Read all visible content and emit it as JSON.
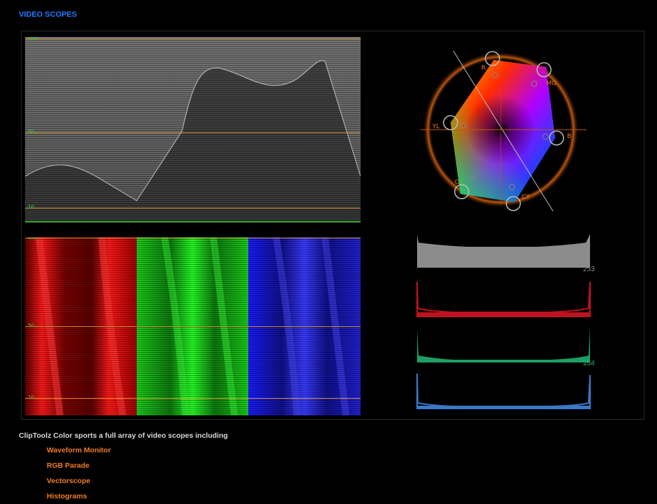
{
  "page": {
    "title": "VIDEO SCOPES",
    "accent_color": "#1f7bff"
  },
  "waveform": {
    "scale_labels": [
      "100",
      "50",
      "10"
    ]
  },
  "parade": {
    "scale_labels": [
      "100",
      "50",
      "10"
    ],
    "channels": [
      "red",
      "green",
      "blue"
    ]
  },
  "vectorscope": {
    "targets": [
      "R",
      "MG",
      "B",
      "CY",
      "G",
      "YL"
    ]
  },
  "histograms": {
    "luma_peak_label": "253",
    "green_peak_label": "254",
    "colors": [
      "#8c8c8c",
      "#c0121e",
      "#1fb070",
      "#3a78c8"
    ]
  },
  "caption": {
    "text": "ClipToolz Color sports a full array of video scopes including",
    "items": [
      "Waveform Monitor",
      "RGB Parade",
      "Vectorscope",
      "Histograms"
    ],
    "item_color": "#f07c1e"
  }
}
